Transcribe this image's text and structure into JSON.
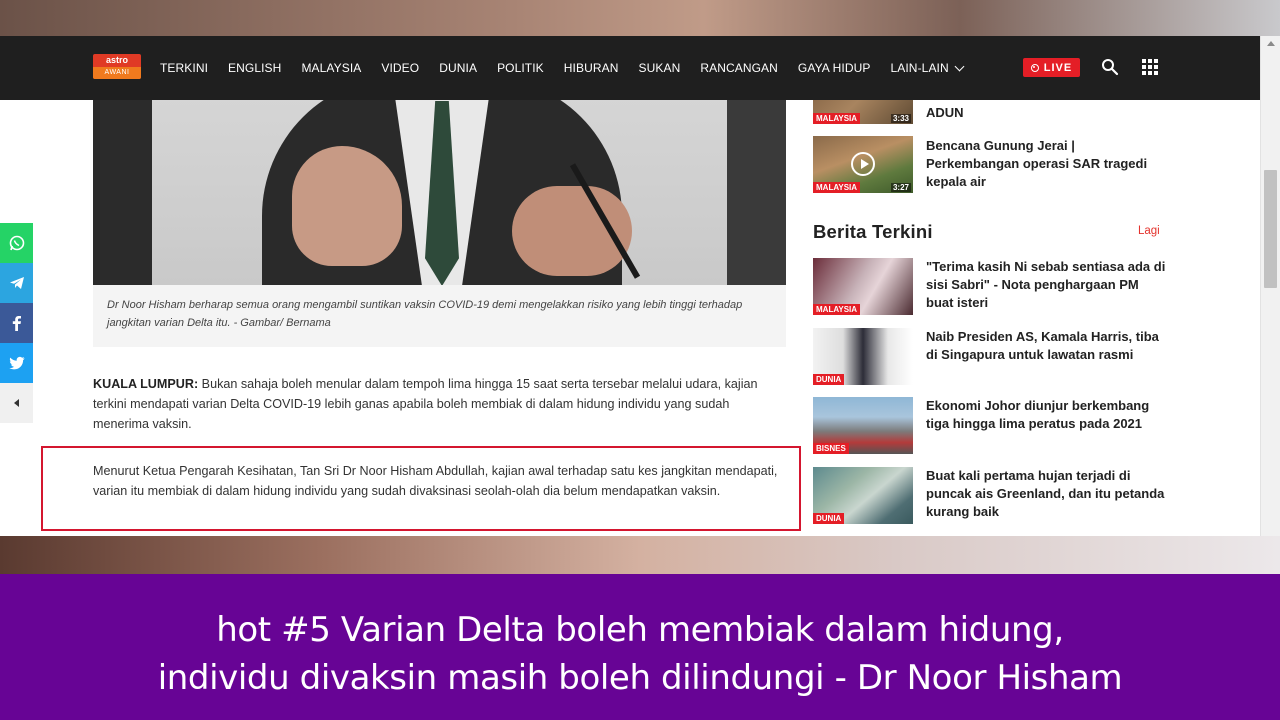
{
  "nav": {
    "logo_top": "astro",
    "logo_bottom": "AWANI",
    "items": [
      "TERKINI",
      "ENGLISH",
      "MALAYSIA",
      "VIDEO",
      "DUNIA",
      "POLITIK",
      "HIBURAN",
      "SUKAN",
      "RANCANGAN",
      "GAYA HIDUP"
    ],
    "more_label": "LAIN-LAIN",
    "live_label": "LIVE"
  },
  "article": {
    "caption": "Dr Noor Hisham berharap semua orang mengambil suntikan vaksin COVID-19 demi mengelakkan risiko yang lebih tinggi terhadap jangkitan varian Delta itu. - Gambar/ Bernama",
    "dateline": "KUALA LUMPUR:",
    "para1": " Bukan sahaja boleh menular dalam tempoh lima hingga 15 saat serta tersebar melalui udara, kajian terkini mendapati varian Delta COVID-19 lebih ganas apabila boleh membiak di dalam hidung individu yang sudah menerima vaksin.",
    "para2": "Menurut Ketua Pengarah Kesihatan, Tan Sri Dr Noor Hisham Abdullah, kajian awal terhadap satu kes jangkitan mendapati, varian itu membiak di dalam hidung individu yang sudah divaksinasi seolah-olah dia belum mendapatkan vaksin."
  },
  "sidebar": {
    "videos": [
      {
        "tag": "MALAYSIA",
        "duration": "3:33",
        "title": "ADUN"
      },
      {
        "tag": "MALAYSIA",
        "duration": "3:27",
        "title": "Bencana Gunung Jerai | Perkembangan operasi SAR tragedi kepala air"
      }
    ],
    "section_title": "Berita Terkini",
    "more_label": "Lagi",
    "news": [
      {
        "tag": "MALAYSIA",
        "title": "\"Terima kasih Ni sebab sentiasa ada di sisi Sabri\" - Nota penghargaan PM buat isteri"
      },
      {
        "tag": "DUNIA",
        "title": "Naib Presiden AS, Kamala Harris, tiba di Singapura untuk lawatan rasmi"
      },
      {
        "tag": "BISNES",
        "title": "Ekonomi Johor diunjur berkembang tiga hingga lima peratus pada 2021"
      },
      {
        "tag": "DUNIA",
        "title": "Buat kali pertama hujan terjadi di puncak ais Greenland, dan itu petanda kurang baik"
      }
    ]
  },
  "banner": {
    "line1": "hot #5 Varian Delta boleh membiak dalam hidung,",
    "line2": "individu divaksin masih boleh dilindungi - Dr Noor Hisham"
  },
  "colors": {
    "nav_bg": "#1f1f1f",
    "accent_red": "#e41e26",
    "banner_purple": "#670495",
    "highlight_border": "#d4162f"
  }
}
